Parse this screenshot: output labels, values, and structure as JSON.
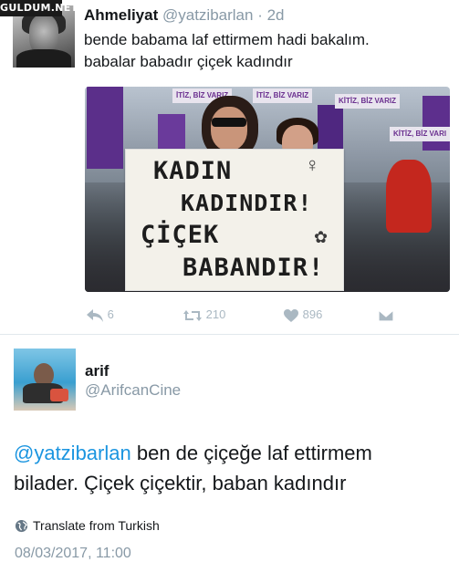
{
  "watermark": "GULDUM.NET",
  "tweet1": {
    "name": "Ahmeliyat",
    "handle": "@yatzibarlan",
    "separator": "·",
    "time": "2d",
    "text_lines": [
      "bende babama laf ettirmem hadi bakalım.",
      "babalar babadır çiçek kadındır"
    ],
    "photo": {
      "sign_lines": [
        "KADIN",
        "KADINDIR!",
        "ÇİÇEK",
        "BABANDIR!"
      ],
      "sign_symbols": [
        "♀",
        "✿"
      ],
      "banner_texts": [
        "İTİZ, BİZ VARIZ",
        "İTİZ, BİZ VARIZ",
        "KİTİZ, BİZ VARIZ",
        "KİTİZ, BİZ VARI"
      ]
    },
    "actions": {
      "replies": "6",
      "retweets": "210",
      "likes": "896"
    }
  },
  "tweet2": {
    "name": "arif",
    "handle": "@ArifcanCine",
    "mention": "@yatzibarlan",
    "text_line1_rest": " ben de çiçeğe laf ettirmem",
    "text_line2": "bilader. Çiçek çiçektir, baban kadındır",
    "translate_label": "Translate from Turkish",
    "timestamp": "08/03/2017, 11:00"
  },
  "colors": {
    "link": "#1b95e0",
    "muted": "#8899a6",
    "icon": "#aab8c2",
    "text": "#14171a"
  },
  "icons": [
    "reply-icon",
    "retweet-icon",
    "like-icon",
    "dm-icon",
    "globe-icon"
  ]
}
